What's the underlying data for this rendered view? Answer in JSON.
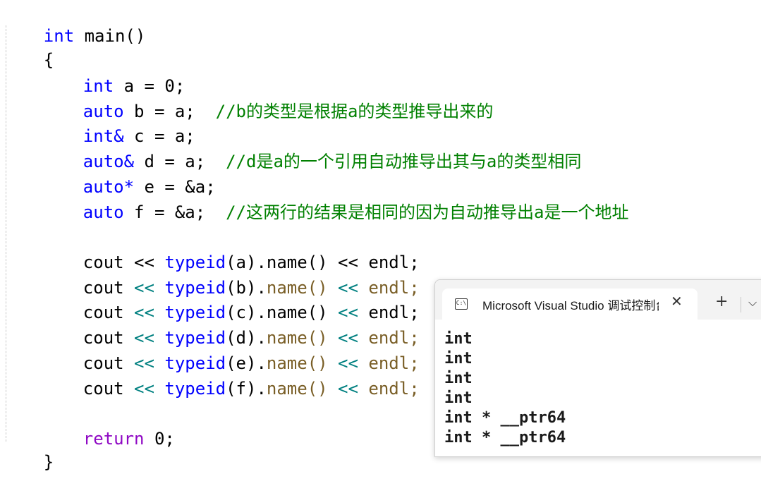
{
  "code": {
    "l1": {
      "type": "int",
      "rest": " main()"
    },
    "l2": "{",
    "l3": {
      "type": "int",
      "rest": " a = 0;"
    },
    "l4": {
      "type": "auto",
      "rest": " b = a;  ",
      "comment": "//b的类型是根据a的类型推导出来的"
    },
    "l5": {
      "type": "int&",
      "rest": " c = a;"
    },
    "l6": {
      "type": "auto&",
      "rest": " d = a;  ",
      "comment": "//d是a的一个引用自动推导出其与a的类型相同"
    },
    "l7": {
      "type": "auto*",
      "rest": " e = &a;"
    },
    "l8": {
      "type": "auto",
      "rest": " f = &a;  ",
      "comment": "//这两行的结果是相同的因为自动推导出a是一个地址"
    },
    "couts": [
      {
        "cout": "cout",
        "op1": " << ",
        "fn": "typeid",
        "arg": "(a)",
        "dot": ".",
        "name": "name()",
        "op2": " << ",
        "endl": "endl;"
      },
      {
        "cout": "cout",
        "op1": " << ",
        "fn": "typeid",
        "arg": "(b)",
        "dot": ".",
        "name": "name()",
        "op2": " << ",
        "endl": "endl;"
      },
      {
        "cout": "cout",
        "op1": " << ",
        "fn": "typeid",
        "arg": "(c)",
        "dot": ".",
        "name": "name()",
        "op2": " << ",
        "endl": "endl;"
      },
      {
        "cout": "cout",
        "op1": " << ",
        "fn": "typeid",
        "arg": "(d)",
        "dot": ".",
        "name": "name()",
        "op2": " << ",
        "endl": "endl;"
      },
      {
        "cout": "cout",
        "op1": " << ",
        "fn": "typeid",
        "arg": "(e)",
        "dot": ".",
        "name": "name()",
        "op2": " << ",
        "endl": "endl;"
      },
      {
        "cout": "cout",
        "op1": " << ",
        "fn": "typeid",
        "arg": "(f)",
        "dot": ".",
        "name": "name()",
        "op2": " << ",
        "endl": "endl;"
      }
    ],
    "ret": {
      "kw": "return",
      "rest": " 0;"
    },
    "close": "}"
  },
  "console": {
    "title": "Microsoft Visual Studio 调试控制台",
    "icon_text": "C:\\",
    "close_glyph": "✕",
    "new_tab_glyph": "+",
    "dropdown_glyph": "⌵",
    "output": [
      "int",
      "int",
      "int",
      "int",
      "int * __ptr64",
      "int * __ptr64"
    ]
  },
  "colors": {
    "keyword": "#0000ff",
    "return_keyword": "#8f08c4",
    "comment": "#008000"
  }
}
